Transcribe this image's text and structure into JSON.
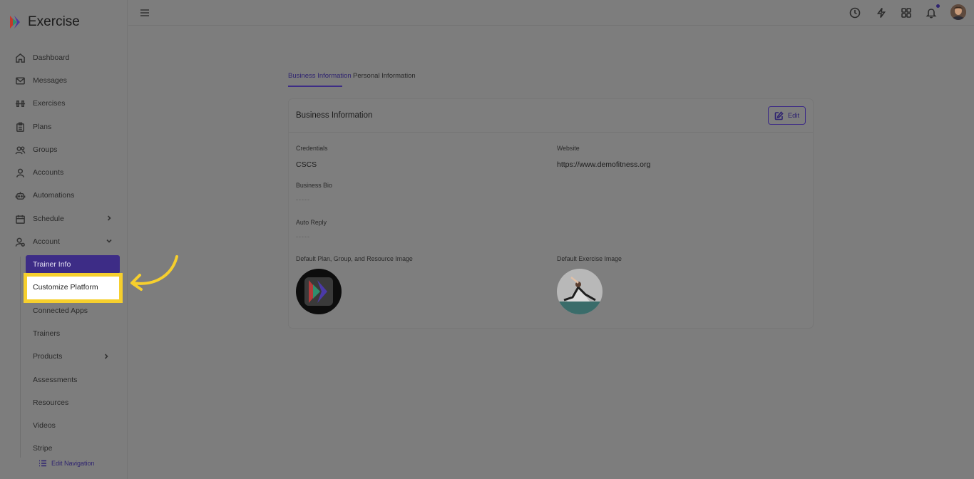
{
  "app": {
    "name": "Exercise"
  },
  "sidebar": {
    "items": [
      {
        "label": "Dashboard",
        "icon": "home-icon"
      },
      {
        "label": "Messages",
        "icon": "mail-icon"
      },
      {
        "label": "Exercises",
        "icon": "dumbbell-icon"
      },
      {
        "label": "Plans",
        "icon": "clipboard-icon"
      },
      {
        "label": "Groups",
        "icon": "users-icon"
      },
      {
        "label": "Accounts",
        "icon": "user-icon"
      },
      {
        "label": "Automations",
        "icon": "robot-icon"
      },
      {
        "label": "Schedule",
        "icon": "calendar-icon"
      },
      {
        "label": "Account",
        "icon": "user-gear-icon"
      }
    ],
    "account_sub": [
      {
        "label": "Trainer Info"
      },
      {
        "label": "Customize Platform"
      },
      {
        "label": "Connected Apps"
      },
      {
        "label": "Trainers"
      },
      {
        "label": "Products"
      },
      {
        "label": "Assessments"
      },
      {
        "label": "Resources"
      },
      {
        "label": "Videos"
      },
      {
        "label": "Stripe"
      }
    ],
    "edit_nav": "Edit Navigation"
  },
  "tabs": [
    {
      "label": "Business Information"
    },
    {
      "label": "Personal Information"
    }
  ],
  "card": {
    "title": "Business Information",
    "edit_label": "Edit",
    "credentials_label": "Credentials",
    "credentials_value": "CSCS",
    "website_label": "Website",
    "website_value": "https://www.demofitness.org",
    "bio_label": "Business Bio",
    "bio_value": "-----",
    "auto_reply_label": "Auto Reply",
    "auto_reply_value": "-----",
    "default_image_label": "Default Plan, Group, and Resource Image",
    "default_exercise_label": "Default Exercise Image"
  },
  "colors": {
    "accent": "#3d2c86",
    "highlight": "#f6cf2d",
    "overlay_bg": "#7d7d7d"
  }
}
